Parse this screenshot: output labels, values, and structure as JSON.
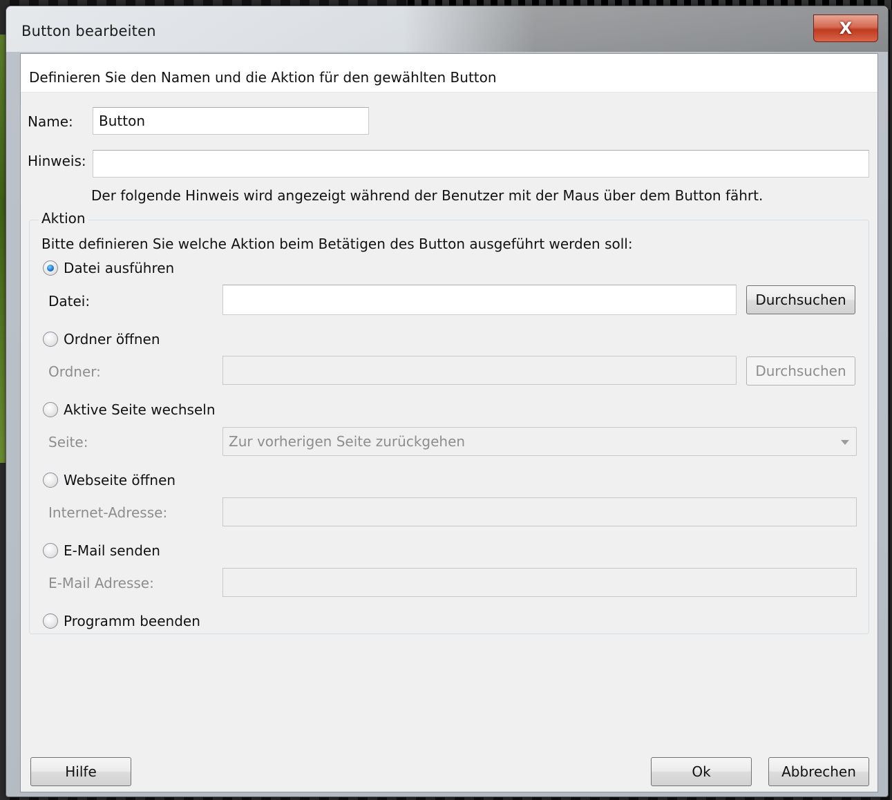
{
  "window": {
    "title": "Button bearbeiten",
    "close_label": "X"
  },
  "header": {
    "description": "Definieren Sie den Namen und die Aktion für den gewählten Button"
  },
  "fields": {
    "name_label": "Name:",
    "name_value": "Button",
    "hint_label": "Hinweis:",
    "hint_value": "",
    "hint_help": "Der folgende Hinweis wird angezeigt während der Benutzer mit der Maus über dem Button fährt."
  },
  "action": {
    "legend": "Aktion",
    "instruction": "Bitte definieren Sie welche Aktion beim Betätigen des Button ausgeführt werden soll:",
    "options": [
      {
        "label": "Datei ausführen",
        "checked": true,
        "field_label": "Datei:",
        "field_value": "",
        "browse_label": "Durchsuchen",
        "enabled": true
      },
      {
        "label": "Ordner öffnen",
        "checked": false,
        "field_label": "Ordner:",
        "field_value": "",
        "browse_label": "Durchsuchen",
        "enabled": false
      },
      {
        "label": "Aktive Seite wechseln",
        "checked": false,
        "field_label": "Seite:",
        "select_value": "Zur vorherigen Seite zurückgehen",
        "enabled": false
      },
      {
        "label": "Webseite öffnen",
        "checked": false,
        "field_label": "Internet-Adresse:",
        "field_value": "",
        "enabled": false
      },
      {
        "label": "E-Mail senden",
        "checked": false,
        "field_label": "E-Mail Adresse:",
        "field_value": "",
        "enabled": false
      },
      {
        "label": "Programm beenden",
        "checked": false,
        "enabled": false
      }
    ]
  },
  "footer": {
    "help_label": "Hilfe",
    "ok_label": "Ok",
    "cancel_label": "Abbrechen"
  }
}
